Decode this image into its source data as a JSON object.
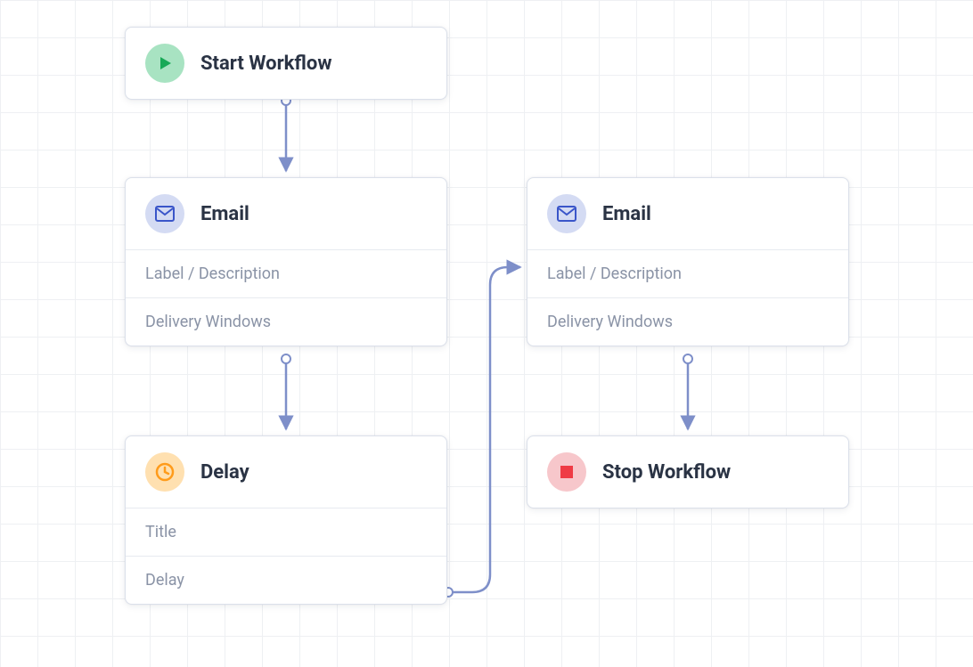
{
  "nodes": {
    "start": {
      "title": "Start Workflow",
      "icon": "play-icon",
      "iconColor": "#18a957"
    },
    "email1": {
      "title": "Email",
      "icon": "envelope-icon",
      "iconColor": "#3a55c9",
      "row1": "Label / Description",
      "row2": "Delivery Windows"
    },
    "email2": {
      "title": "Email",
      "icon": "envelope-icon",
      "iconColor": "#3a55c9",
      "row1": "Label / Description",
      "row2": "Delivery Windows"
    },
    "delay": {
      "title": "Delay",
      "icon": "clock-icon",
      "iconColor": "#ff9b1a",
      "row1": "Title",
      "row2": "Delay"
    },
    "stop": {
      "title": "Stop Workflow",
      "icon": "stop-icon",
      "iconColor": "#ef3b45"
    }
  },
  "colors": {
    "connector": "#7e8fc9",
    "connectorEnd": "#7e8fc9"
  }
}
